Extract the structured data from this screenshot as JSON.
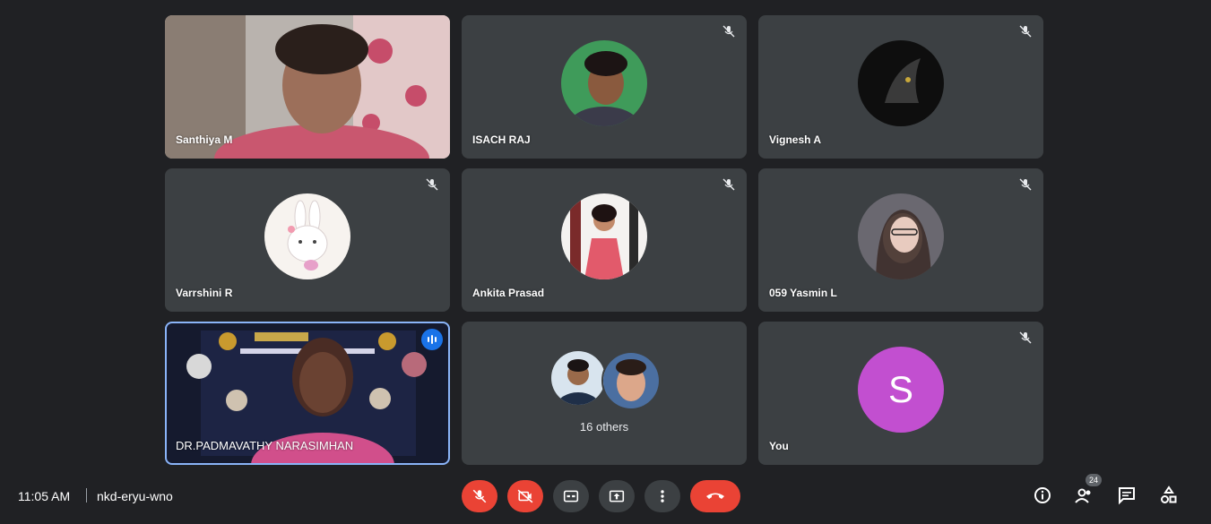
{
  "participants": [
    {
      "name": "Santhiya M",
      "muted": false
    },
    {
      "name": "ISACH RAJ",
      "muted": true
    },
    {
      "name": "Vignesh A",
      "muted": true
    },
    {
      "name": "Varrshini R",
      "muted": true
    },
    {
      "name": "Ankita Prasad",
      "muted": true
    },
    {
      "name": "059 Yasmin L",
      "muted": true
    },
    {
      "name": "DR.PADMAVATHY NARASIMHAN",
      "muted": false,
      "speaking": true
    },
    {
      "name": "16 others"
    },
    {
      "name": "You",
      "initial": "S",
      "muted": true
    }
  ],
  "bottombar": {
    "time": "11:05 AM",
    "separator": "|",
    "meeting_code": "nkd-eryu-wno",
    "people_count": "24"
  },
  "controls": [
    {
      "icon": "mic-off-icon"
    },
    {
      "icon": "camera-off-icon"
    },
    {
      "icon": "captions-icon"
    },
    {
      "icon": "present-icon"
    },
    {
      "icon": "more-options-icon"
    },
    {
      "icon": "leave-call-icon"
    }
  ],
  "right_icons": [
    "info-icon",
    "people-icon",
    "chat-icon",
    "activities-icon"
  ],
  "colors": {
    "background": "#202124",
    "tile": "#3c4043",
    "danger": "#ea4335",
    "avatar_you": "#c24fd0",
    "speaking_outline": "#8ab4f8"
  }
}
